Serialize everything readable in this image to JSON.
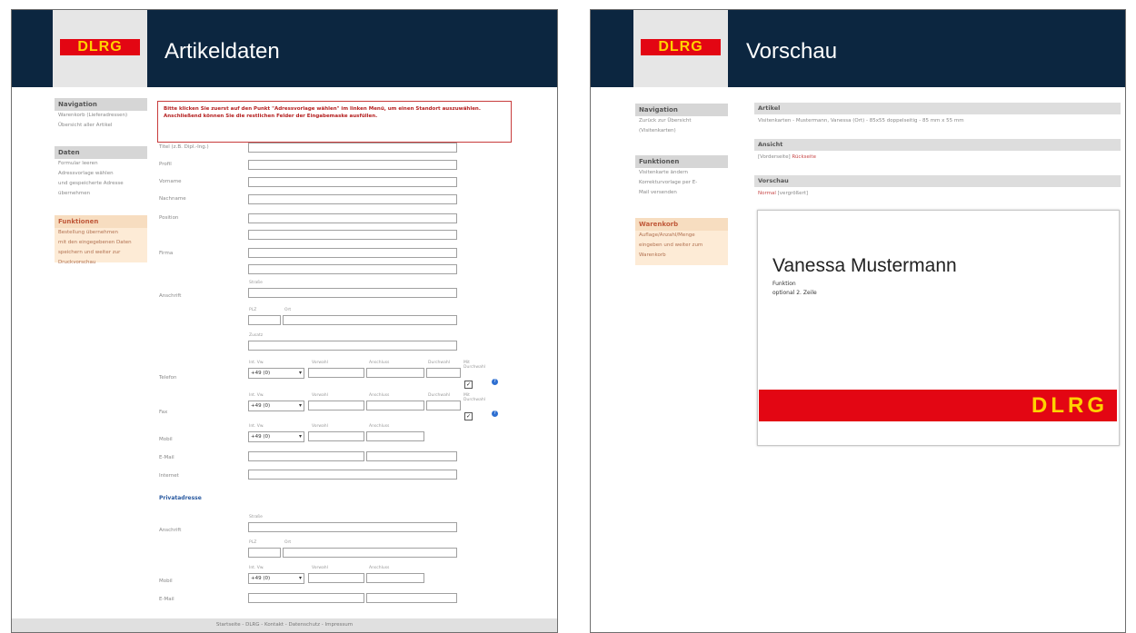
{
  "left": {
    "logo": "DLRG",
    "title": "Artikeldaten",
    "nav": {
      "head": "Navigation",
      "items": [
        "Warenkorb (Lieferadressen)",
        "Übersicht aller Artikel"
      ]
    },
    "daten": {
      "head": "Daten",
      "items": [
        "Formular leeren",
        "Adressvorlage wählen",
        "und gespeicherte Adresse",
        "übernehmen"
      ]
    },
    "funktionen": {
      "head": "Funktionen",
      "items": [
        "Bestellung übernehmen",
        "mit den eingegebenen Daten",
        "speichern und weiter zur",
        "Druckvorschau"
      ]
    },
    "alert": "Bitte klicken Sie zuerst auf den Punkt \"Adressvorlage wählen\" im linken Menü, um einen Standort auszuwählen. Anschließend können Sie die restlichen Felder der Eingabemaske ausfüllen.",
    "fields": {
      "titel": "Titel (z.B. Dipl.-Ing.)",
      "profil": "Profil",
      "vorname": "Vorname",
      "nachname": "Nachname",
      "position": "Position",
      "firma": "Firma",
      "anschrift": "Anschrift",
      "strasse": "Straße",
      "plz": "PLZ",
      "ort": "Ort",
      "zusatz": "Zusatz",
      "telefon": "Telefon",
      "fax": "Fax",
      "mobil": "Mobil",
      "email": "E-Mail",
      "internet": "Internet",
      "landvorwahl": "Int. Vw.",
      "vorwahl": "Vorwahl",
      "anschluss": "Anschluss",
      "durchwahl": "Durchwahl",
      "mit_durchwahl": "Mit Durchwahl",
      "country_code": "+49 (0)",
      "section_privat": "Privatadresse",
      "p_anschrift": "Anschrift",
      "p_mobil": "Mobil",
      "p_email": "E-Mail"
    },
    "footer": "Startseite - DLRG - Kontakt - Datenschutz - Impressum"
  },
  "right": {
    "logo": "DLRG",
    "title": "Vorschau",
    "nav": {
      "head": "Navigation",
      "items": [
        "Zurück zur Übersicht",
        "(Visitenkarten)"
      ]
    },
    "funktionen": {
      "head": "Funktionen",
      "items": [
        "Visitenkarte ändern",
        "Korrekturvorlage per E-",
        "Mail versenden"
      ]
    },
    "warenkorb": {
      "head": "Warenkorb",
      "items": [
        "Auflage/Anzahl/Menge",
        "eingeben und weiter zum",
        "Warenkorb"
      ]
    },
    "artikel": {
      "head": "Artikel",
      "line": "Visitenkarten - Mustermann, Vanessa (Ort) - 85x55 doppelseitig - 85 mm x 55 mm"
    },
    "ansicht": {
      "head": "Ansicht",
      "text": "[Vorderseite]",
      "link": "Rückseite"
    },
    "vorschau": {
      "head": "Vorschau",
      "text": "Normal",
      "text2": "[vergrößert]"
    },
    "card": {
      "name": "Vanessa Mustermann",
      "line1": "Funktion",
      "line2": "optional 2. Zeile",
      "logo": "DLRG"
    }
  },
  "colors": {
    "header": "#0c2640",
    "dlrg_red": "#e30613",
    "dlrg_yellow": "#ffd200",
    "orange_panel": "#fdebd6",
    "alert_border": "#c83c3c"
  }
}
